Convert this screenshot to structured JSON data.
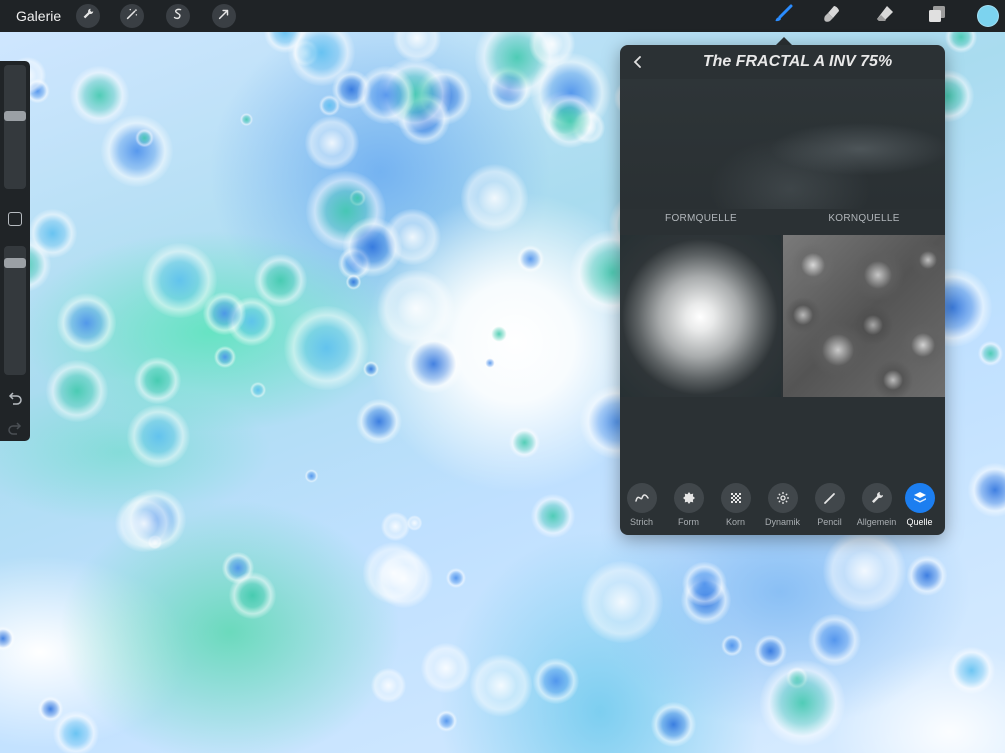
{
  "topbar": {
    "gallery_label": "Galerie",
    "left_tools": [
      "wrench-icon",
      "magic-wand-icon",
      "selection-icon",
      "transform-arrow-icon"
    ],
    "right_tools": [
      "brush-icon",
      "smudge-icon",
      "eraser-icon",
      "layers-icon"
    ],
    "active_tool": "brush-icon",
    "accent_color": "#1c7ef0",
    "current_color": "#7cd3ef"
  },
  "sidebar": {
    "brush_size_level": 0.6,
    "opacity_level": 0.9,
    "modify_icon": "square-icon",
    "undo_icon": "undo-icon",
    "redo_icon": "redo-icon"
  },
  "brush_panel": {
    "title": "The FRACTAL A INV 75%",
    "shape_source_label": "FORMQUELLE",
    "grain_source_label": "KORNQUELLE",
    "tabs": [
      {
        "label": "Strich",
        "icon": "stroke-path-icon",
        "active": false
      },
      {
        "label": "Form",
        "icon": "shape-icon",
        "active": false
      },
      {
        "label": "Korn",
        "icon": "grain-icon",
        "active": false
      },
      {
        "label": "Dynamik",
        "icon": "dynamics-icon",
        "active": false
      },
      {
        "label": "Pencil",
        "icon": "pencil-icon",
        "active": false
      },
      {
        "label": "Allgemein",
        "icon": "wrench-icon",
        "active": false
      },
      {
        "label": "Quelle",
        "icon": "source-icon",
        "active": true
      }
    ]
  }
}
